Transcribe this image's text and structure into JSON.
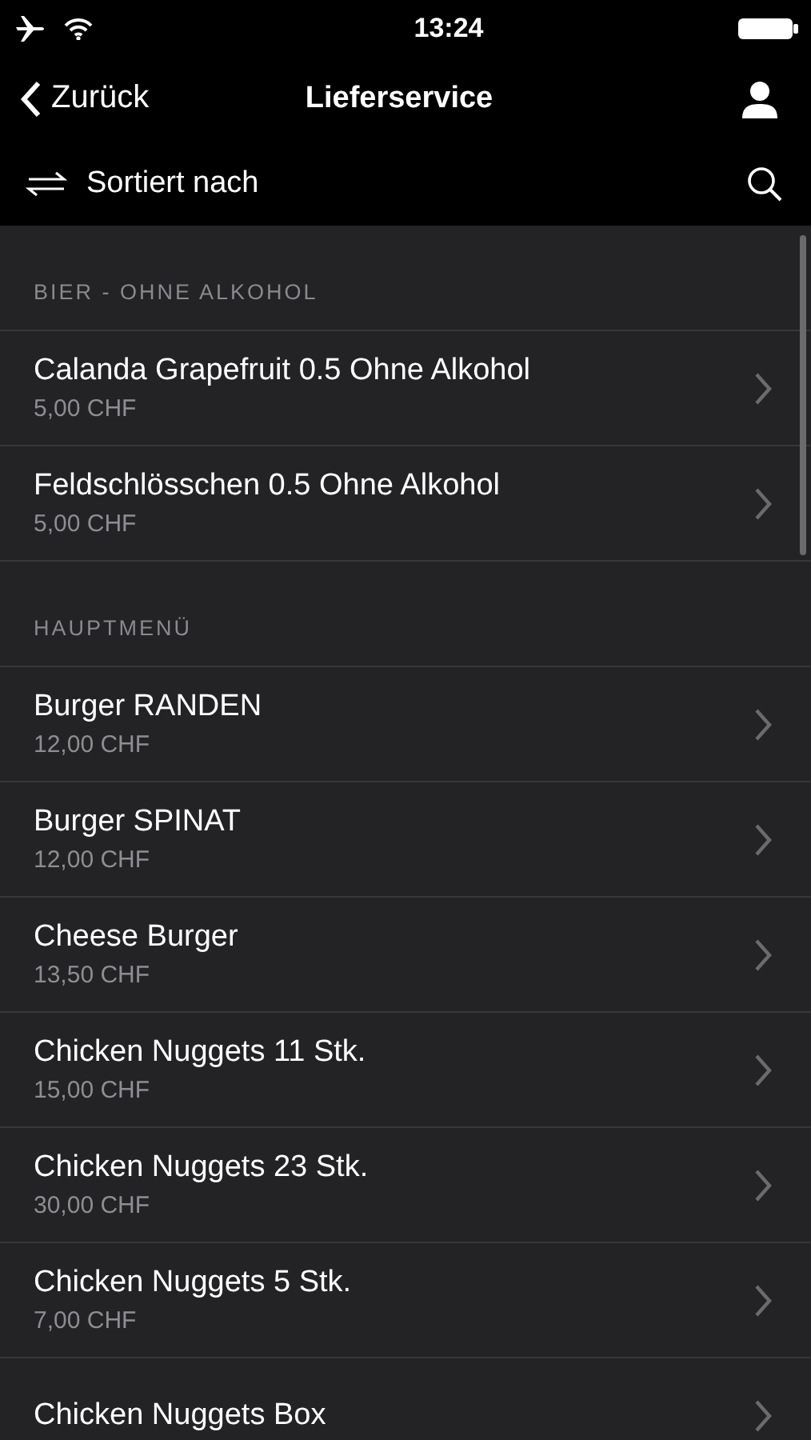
{
  "status_bar": {
    "time": "13:24"
  },
  "nav": {
    "back": "Zurück",
    "title": "Lieferservice"
  },
  "toolbar": {
    "sort_label": "Sortiert nach"
  },
  "sections": [
    {
      "title": "BIER - OHNE ALKOHOL",
      "items": [
        {
          "name": "Calanda Grapefruit 0.5 Ohne Alkohol",
          "price": "5,00 CHF"
        },
        {
          "name": "Feldschlösschen 0.5 Ohne Alkohol",
          "price": "5,00 CHF"
        }
      ]
    },
    {
      "title": "HAUPTMENÜ",
      "items": [
        {
          "name": "Burger RANDEN",
          "price": "12,00 CHF"
        },
        {
          "name": "Burger SPINAT",
          "price": "12,00 CHF"
        },
        {
          "name": "Cheese Burger",
          "price": "13,50 CHF"
        },
        {
          "name": "Chicken Nuggets 11 Stk.",
          "price": "15,00 CHF"
        },
        {
          "name": "Chicken Nuggets 23 Stk.",
          "price": "30,00 CHF"
        },
        {
          "name": "Chicken Nuggets 5 Stk.",
          "price": "7,00 CHF"
        },
        {
          "name": "Chicken Nuggets Box"
        }
      ]
    }
  ]
}
